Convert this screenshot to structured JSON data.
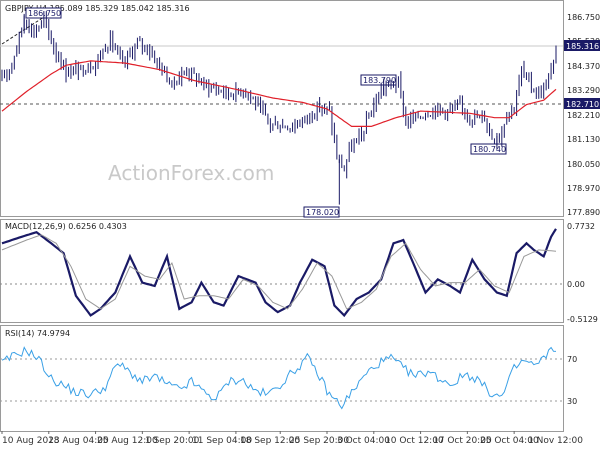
{
  "chart_data": [
    {
      "type": "candlestick",
      "title": "GBPJPY,H4  185.089 185.329 185.042 185.316",
      "watermark": "ActionForex.com",
      "ylim": [
        177.59,
        187.25
      ],
      "yticks": [
        "186.750",
        "185.530",
        "184.370",
        "183.290",
        "182.210",
        "181.130",
        "180.050",
        "178.970",
        "177.890"
      ],
      "ytick_values": [
        186.75,
        185.53,
        184.37,
        183.29,
        182.21,
        181.13,
        180.05,
        178.97,
        177.89
      ],
      "last_price": {
        "label": "185.316",
        "value": 185.316,
        "color": "#1a1a66"
      },
      "level": {
        "label": "182.710",
        "value": 182.71,
        "color": "#1a1a66"
      },
      "annotations": [
        {
          "label": "186.750",
          "x": 9,
          "value": 186.75
        },
        {
          "label": "183.790",
          "x": 155,
          "value": 183.79
        },
        {
          "label": "178.020",
          "x": 137,
          "value": 178.02
        },
        {
          "label": "180.740",
          "x": 201,
          "value": 180.74
        }
      ],
      "ma_color": "#e0202a",
      "candle_color": "#1a1a66",
      "series": [
        {
          "name": "candles",
          "anchors": [
            [
              0,
              183.7
            ],
            [
              4,
              184.5
            ],
            [
              9,
              186.5
            ],
            [
              13,
              185.9
            ],
            [
              17,
              186.5
            ],
            [
              21,
              185.2
            ],
            [
              26,
              184.1
            ],
            [
              32,
              184.2
            ],
            [
              38,
              184.5
            ],
            [
              44,
              185.6
            ],
            [
              49,
              184.4
            ],
            [
              55,
              185.4
            ],
            [
              59,
              185.2
            ],
            [
              64,
              184.4
            ],
            [
              69,
              183.5
            ],
            [
              75,
              184.2
            ],
            [
              82,
              183.5
            ],
            [
              93,
              183.1
            ],
            [
              99,
              183.3
            ],
            [
              109,
              181.7
            ],
            [
              118,
              181.6
            ],
            [
              124,
              182.0
            ],
            [
              129,
              182.5
            ],
            [
              133,
              182.3
            ],
            [
              136,
              180.2
            ],
            [
              139,
              179.6
            ],
            [
              141,
              180.5
            ],
            [
              146,
              181.2
            ],
            [
              151,
              182.6
            ],
            [
              155,
              183.4
            ],
            [
              158,
              183.5
            ],
            [
              161,
              183.6
            ],
            [
              164,
              181.8
            ],
            [
              170,
              182.1
            ],
            [
              176,
              182.4
            ],
            [
              181,
              182.3
            ],
            [
              186,
              182.5
            ],
            [
              191,
              182.0
            ],
            [
              196,
              182.0
            ],
            [
              199,
              181.1
            ],
            [
              202,
              181.1
            ],
            [
              205,
              182.2
            ],
            [
              208,
              182.5
            ],
            [
              211,
              184.2
            ],
            [
              215,
              183.4
            ],
            [
              218,
              183.1
            ],
            [
              221,
              183.5
            ],
            [
              224,
              184.4
            ],
            [
              225,
              185.3
            ]
          ]
        },
        {
          "name": "ma",
          "anchors": [
            [
              0,
              182.3
            ],
            [
              10,
              183.2
            ],
            [
              20,
              184.0
            ],
            [
              26,
              184.4
            ],
            [
              36,
              184.6
            ],
            [
              50,
              184.5
            ],
            [
              64,
              184.2
            ],
            [
              78,
              183.7
            ],
            [
              95,
              183.3
            ],
            [
              110,
              182.9
            ],
            [
              122,
              182.7
            ],
            [
              132,
              182.4
            ],
            [
              137,
              182.0
            ],
            [
              142,
              181.6
            ],
            [
              150,
              181.6
            ],
            [
              160,
              182.0
            ],
            [
              170,
              182.3
            ],
            [
              190,
              182.2
            ],
            [
              200,
              182.0
            ],
            [
              206,
              182.0
            ],
            [
              213,
              182.6
            ],
            [
              220,
              182.8
            ],
            [
              225,
              183.3
            ]
          ]
        }
      ]
    },
    {
      "type": "line",
      "title": "MACD(12,26,9) 0.6256 0.4303",
      "ylim": [
        -0.62,
        0.86
      ],
      "yticks": [
        "0.7732",
        "0.00",
        "-0.5129"
      ],
      "ytick_values": [
        0.7732,
        0.0,
        -0.5129
      ],
      "series": [
        {
          "name": "MACD",
          "color": "#1a1a66",
          "anchors": [
            [
              0,
              0.55
            ],
            [
              8,
              0.65
            ],
            [
              14,
              0.72
            ],
            [
              20,
              0.55
            ],
            [
              25,
              0.4
            ],
            [
              30,
              -0.25
            ],
            [
              36,
              -0.55
            ],
            [
              40,
              -0.45
            ],
            [
              46,
              -0.2
            ],
            [
              52,
              0.35
            ],
            [
              57,
              -0.05
            ],
            [
              62,
              -0.1
            ],
            [
              67,
              0.35
            ],
            [
              72,
              -0.45
            ],
            [
              77,
              -0.35
            ],
            [
              81,
              -0.05
            ],
            [
              86,
              -0.35
            ],
            [
              90,
              -0.4
            ],
            [
              96,
              0.05
            ],
            [
              103,
              -0.05
            ],
            [
              107,
              -0.35
            ],
            [
              112,
              -0.5
            ],
            [
              117,
              -0.4
            ],
            [
              121,
              -0.05
            ],
            [
              126,
              0.3
            ],
            [
              131,
              0.2
            ],
            [
              135,
              -0.4
            ],
            [
              139,
              -0.55
            ],
            [
              144,
              -0.3
            ],
            [
              149,
              -0.2
            ],
            [
              154,
              0.0
            ],
            [
              159,
              0.55
            ],
            [
              163,
              0.6
            ],
            [
              167,
              0.25
            ],
            [
              172,
              -0.2
            ],
            [
              177,
              0.0
            ],
            [
              182,
              -0.1
            ],
            [
              186,
              -0.2
            ],
            [
              191,
              0.3
            ],
            [
              196,
              0.0
            ],
            [
              201,
              -0.2
            ],
            [
              205,
              -0.25
            ],
            [
              209,
              0.4
            ],
            [
              213,
              0.55
            ],
            [
              216,
              0.45
            ],
            [
              220,
              0.35
            ],
            [
              223,
              0.65
            ],
            [
              225,
              0.77
            ]
          ]
        },
        {
          "name": "Signal",
          "color": "#999999",
          "anchors": [
            [
              0,
              0.45
            ],
            [
              10,
              0.6
            ],
            [
              16,
              0.68
            ],
            [
              22,
              0.55
            ],
            [
              28,
              0.2
            ],
            [
              34,
              -0.3
            ],
            [
              40,
              -0.45
            ],
            [
              46,
              -0.3
            ],
            [
              52,
              0.2
            ],
            [
              58,
              0.05
            ],
            [
              64,
              0.0
            ],
            [
              69,
              0.25
            ],
            [
              74,
              -0.3
            ],
            [
              80,
              -0.25
            ],
            [
              86,
              -0.25
            ],
            [
              92,
              -0.3
            ],
            [
              98,
              0.0
            ],
            [
              104,
              -0.1
            ],
            [
              110,
              -0.35
            ],
            [
              116,
              -0.45
            ],
            [
              122,
              -0.15
            ],
            [
              128,
              0.25
            ],
            [
              134,
              0.05
            ],
            [
              140,
              -0.45
            ],
            [
              146,
              -0.35
            ],
            [
              152,
              -0.15
            ],
            [
              158,
              0.35
            ],
            [
              164,
              0.55
            ],
            [
              170,
              0.15
            ],
            [
              176,
              -0.1
            ],
            [
              182,
              -0.05
            ],
            [
              188,
              -0.05
            ],
            [
              194,
              0.15
            ],
            [
              200,
              -0.1
            ],
            [
              206,
              -0.2
            ],
            [
              212,
              0.35
            ],
            [
              218,
              0.45
            ],
            [
              225,
              0.43
            ]
          ]
        }
      ]
    },
    {
      "type": "line",
      "title": "RSI(14) 74.9794",
      "ylim": [
        12,
        88
      ],
      "yticks": [
        "70",
        "30"
      ],
      "ytick_values": [
        70,
        30
      ],
      "series": [
        {
          "name": "RSI",
          "color": "#3aa0e6",
          "anchors": [
            [
              0,
              62
            ],
            [
              5,
              68
            ],
            [
              10,
              72
            ],
            [
              15,
              65
            ],
            [
              20,
              50
            ],
            [
              25,
              45
            ],
            [
              30,
              40
            ],
            [
              36,
              38
            ],
            [
              42,
              44
            ],
            [
              47,
              62
            ],
            [
              52,
              55
            ],
            [
              57,
              48
            ],
            [
              62,
              52
            ],
            [
              67,
              46
            ],
            [
              72,
              42
            ],
            [
              77,
              48
            ],
            [
              82,
              40
            ],
            [
              87,
              35
            ],
            [
              92,
              48
            ],
            [
              97,
              50
            ],
            [
              102,
              42
            ],
            [
              108,
              38
            ],
            [
              113,
              46
            ],
            [
              118,
              55
            ],
            [
              124,
              66
            ],
            [
              128,
              55
            ],
            [
              133,
              38
            ],
            [
              138,
              30
            ],
            [
              143,
              42
            ],
            [
              148,
              54
            ],
            [
              153,
              62
            ],
            [
              158,
              66
            ],
            [
              163,
              58
            ],
            [
              168,
              52
            ],
            [
              173,
              56
            ],
            [
              178,
              50
            ],
            [
              183,
              46
            ],
            [
              188,
              54
            ],
            [
              193,
              50
            ],
            [
              198,
              40
            ],
            [
              203,
              36
            ],
            [
              208,
              58
            ],
            [
              212,
              64
            ],
            [
              217,
              60
            ],
            [
              221,
              68
            ],
            [
              225,
              74
            ]
          ]
        }
      ]
    }
  ],
  "xaxis": {
    "labels": [
      "10 Aug 2023",
      "18 Aug 04:00",
      "25 Aug 12:00",
      "1 Sep 20:00",
      "11 Sep 04:00",
      "18 Sep 12:00",
      "25 Sep 20:00",
      "3 Oct 04:00",
      "10 Oct 12:00",
      "17 Oct 20:00",
      "25 Oct 04:00",
      "1 Nov 12:00"
    ],
    "positions": [
      0,
      19,
      38,
      57,
      76,
      95,
      113,
      132,
      151,
      170,
      189,
      208
    ]
  }
}
